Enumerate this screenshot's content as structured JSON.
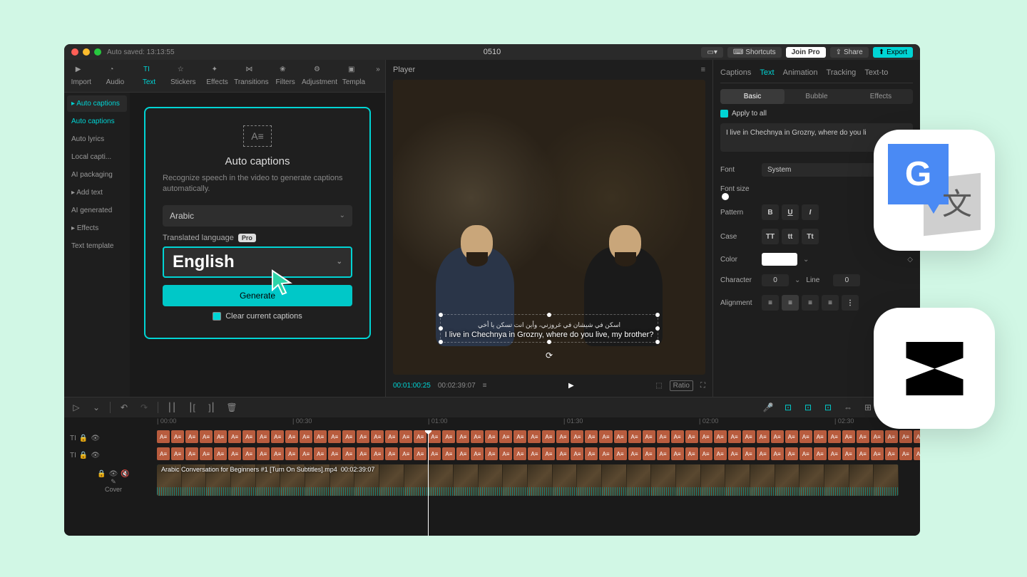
{
  "titlebar": {
    "autosave": "Auto saved: 13:13:55",
    "title": "0510",
    "shortcuts": "Shortcuts",
    "joinpro": "Join Pro",
    "share": "Share",
    "export": "Export"
  },
  "tool_tabs": [
    "Import",
    "Audio",
    "Text",
    "Stickers",
    "Effects",
    "Transitions",
    "Filters",
    "Adjustment",
    "Templa"
  ],
  "left_nav": {
    "items": [
      "Auto captions",
      "Auto captions",
      "Auto lyrics",
      "Local capti...",
      "AI packaging",
      "Add text",
      "AI generated",
      "Effects",
      "Text template"
    ],
    "active_index": 0,
    "sel_index": 1
  },
  "caption_card": {
    "title": "Auto captions",
    "desc": "Recognize speech in the video to generate captions automatically.",
    "lang_source": "Arabic",
    "translated_label": "Translated language",
    "pro": "Pro",
    "lang_target": "English",
    "generate": "Generate",
    "clear": "Clear current captions"
  },
  "player": {
    "label": "Player",
    "caption_ar": "اسكن في شيشان في غروزني، وأين انت تسكن يا أخي",
    "caption_en": "I live in Chechnya in Grozny, where do you live, my brother?",
    "time_current": "00:01:00:25",
    "time_total": "00:02:39:07",
    "ratio": "Ratio"
  },
  "right_panel": {
    "tabs": [
      "Captions",
      "Text",
      "Animation",
      "Tracking",
      "Text-to"
    ],
    "sub_tabs": [
      "Basic",
      "Bubble",
      "Effects"
    ],
    "apply_all": "Apply to all",
    "caption_text": "I live in Chechnya in Grozny, where do you li",
    "font_label": "Font",
    "font_value": "System",
    "fontsize_label": "Font size",
    "pattern_label": "Pattern",
    "case_label": "Case",
    "color_label": "Color",
    "char_label": "Character",
    "char_value": "0",
    "line_label": "Line",
    "line_value": "0",
    "align_label": "Alignment"
  },
  "timeline": {
    "ruler": [
      "00:00",
      "00:30",
      "01:00",
      "01:30",
      "02:00",
      "02:30"
    ],
    "video_clip_name": "Arabic Conversation for Beginners #1 [Turn On Subtitles].mp4",
    "video_clip_dur": "00:02:39:07",
    "cover": "Cover"
  }
}
